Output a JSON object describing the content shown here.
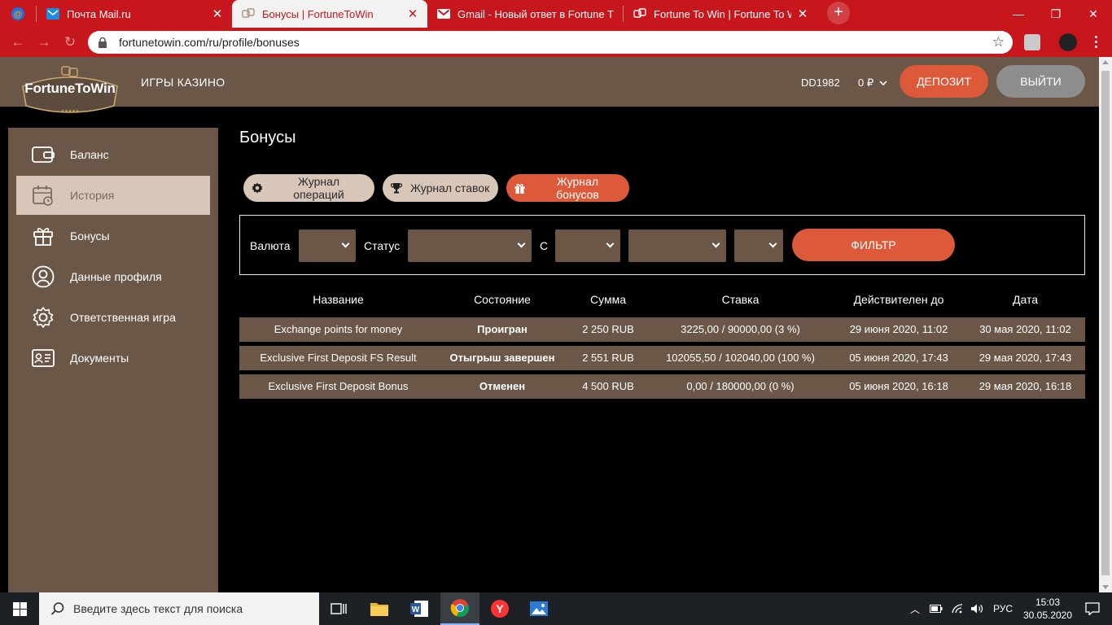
{
  "browser": {
    "tabs": [
      {
        "title": "",
        "favicon": "mail-at-icon",
        "active": false
      },
      {
        "title": "Почта Mail.ru",
        "favicon": "mail-envelope-icon",
        "active": false
      },
      {
        "title": "Бонусы | FortuneToWin",
        "favicon": "dice-icon",
        "active": true
      },
      {
        "title": "Gmail - Новый ответ в Fortune T",
        "favicon": "gmail-icon",
        "active": false
      },
      {
        "title": "Fortune To Win | Fortune To Win",
        "favicon": "dice-icon",
        "active": false
      }
    ],
    "url": "fortunetowin.com/ru/profile/bonuses"
  },
  "header": {
    "logo_text": "FortuneToWin",
    "nav_casino": "ИГРЫ КАЗИНО",
    "username": "DD1982",
    "balance": "0 ₽",
    "deposit_label": "ДЕПОЗИТ",
    "logout_label": "ВЫЙТИ"
  },
  "sidebar": {
    "items": [
      {
        "label": "Баланс",
        "icon": "wallet-icon",
        "active": false
      },
      {
        "label": "История",
        "icon": "calendar-history-icon",
        "active": true
      },
      {
        "label": "Бонусы",
        "icon": "gift-icon",
        "active": false
      },
      {
        "label": "Данные профиля",
        "icon": "user-icon",
        "active": false
      },
      {
        "label": "Ответственная игра",
        "icon": "gear-icon",
        "active": false
      },
      {
        "label": "Документы",
        "icon": "id-card-icon",
        "active": false
      }
    ]
  },
  "main": {
    "title": "Бонусы",
    "tabs": [
      {
        "label": "Журнал операций",
        "icon": "gear-icon",
        "active": false
      },
      {
        "label": "Журнал ставок",
        "icon": "trophy-icon",
        "active": false
      },
      {
        "label": "Журнал бонусов",
        "icon": "gift-icon",
        "active": true
      }
    ],
    "filter": {
      "currency_label": "Валюта",
      "status_label": "Статус",
      "from_label": "С",
      "filter_button": "ФИЛЬТР"
    },
    "table": {
      "headers": [
        "Название",
        "Состояние",
        "Сумма",
        "Ставка",
        "Действителен до",
        "Дата"
      ],
      "rows": [
        [
          "Exchange points for money",
          "Проигран",
          "2 250 RUB",
          "3225,00 / 90000,00 (3 %)",
          "29 июня 2020, 11:02",
          "30 мая 2020, 11:02"
        ],
        [
          "Exclusive First Deposit FS Result",
          "Отыгрыш завершен",
          "2 551 RUB",
          "102055,50 / 102040,00 (100 %)",
          "05 июня 2020, 17:43",
          "29 мая 2020, 17:43"
        ],
        [
          "Exclusive First Deposit Bonus",
          "Отменен",
          "4 500 RUB",
          "0,00 / 180000,00 (0 %)",
          "05 июня 2020, 16:18",
          "29 мая 2020, 16:18"
        ]
      ]
    }
  },
  "taskbar": {
    "search_placeholder": "Введите здесь текст для поиска",
    "language": "РУС",
    "time": "15:03",
    "date": "30.05.2020"
  },
  "colors": {
    "browser_red": "#c8161d",
    "brown": "#6b5747",
    "beige": "#d8c7b9",
    "accent_orange": "#dc5a3a"
  }
}
